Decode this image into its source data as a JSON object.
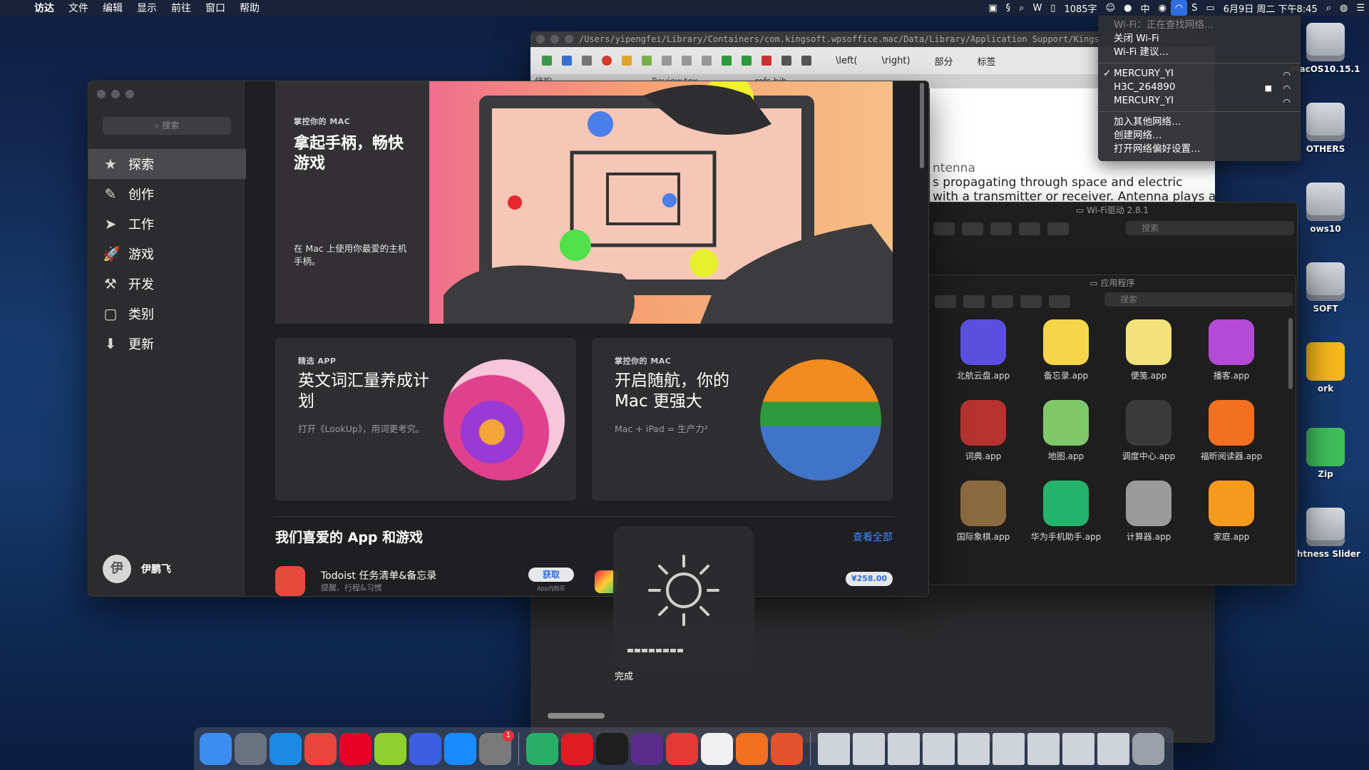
{
  "menubar": {
    "apple": "",
    "items": [
      "访达",
      "文件",
      "编辑",
      "显示",
      "前往",
      "窗口",
      "帮助"
    ],
    "status": {
      "word_count": "1085字",
      "input": "中",
      "datetime": "6月9日 周二 下午8:45"
    }
  },
  "wifi_menu": {
    "status": "Wi-Fi：正在查找网络…",
    "turn_off": "关闭 Wi-Fi",
    "suggestions": "Wi-Fi 建议…",
    "networks": [
      {
        "name": "MERCURY_YI",
        "checked": true,
        "locked": false
      },
      {
        "name": "H3C_264890",
        "checked": false,
        "locked": true
      },
      {
        "name": "MERCURY_YI",
        "checked": false,
        "locked": false
      }
    ],
    "join_other": "加入其他网络…",
    "create": "创建网络…",
    "prefs": "打开网络偏好设置…"
  },
  "desktop": {
    "icons": [
      "MacOS10.15.1",
      "OTHERS",
      "ows10",
      "SOFT",
      "ork",
      "Zip",
      "ghtness Slider"
    ]
  },
  "wps": {
    "path": "/Users/yipengfei/Library/Containers/com.kingsoft.wpsoffice.mac/Data/Library/Application Support/Kingsoft/WPS Cloud Files",
    "toolbar": {
      "left": "\\left(",
      "right": "\\right)",
      "part": "部分",
      "label": "标签"
    },
    "tabs": [
      "结构",
      "Review.tex",
      "refs.bib"
    ],
    "doc_lines": [
      "ntenna",
      "s propagating through space and electric",
      "with a transmitter or receiver.  Antenna plays a"
    ]
  },
  "finder_back": {
    "title": "Wi-Fi驱动 2.8.1",
    "search": "搜索"
  },
  "finder_front": {
    "title": "应用程序",
    "search": "搜索",
    "apps": [
      {
        "name": "北航云盘.app",
        "icon": "beihang-icon",
        "color": "#5b4fe0"
      },
      {
        "name": "备忘录.app",
        "icon": "notes-icon",
        "color": "#f7d54a"
      },
      {
        "name": "便笺.app",
        "icon": "stickies-icon",
        "color": "#f2e27a"
      },
      {
        "name": "播客.app",
        "icon": "podcasts-icon",
        "color": "#b54ad6"
      },
      {
        "name": "词典.app",
        "icon": "dictionary-icon",
        "color": "#b5322f"
      },
      {
        "name": "地图.app",
        "icon": "maps-icon",
        "color": "#7fc86a"
      },
      {
        "name": "调度中心.app",
        "icon": "mission-control-icon",
        "color": "#3a3a3a"
      },
      {
        "name": "福昕阅读器.app",
        "icon": "foxit-reader-icon",
        "color": "#f37021"
      },
      {
        "name": "国际象棋.app",
        "icon": "chess-icon",
        "color": "#8a6a40"
      },
      {
        "name": "华为手机助手.app",
        "icon": "huawei-hisuite-icon",
        "color": "#24b36b"
      },
      {
        "name": "计算器.app",
        "icon": "calculator-icon",
        "color": "#9a9a9a"
      },
      {
        "name": "家庭.app",
        "icon": "home-icon",
        "color": "#f59a1e"
      }
    ]
  },
  "appstore": {
    "search_placeholder": "搜索",
    "nav": [
      {
        "label": "探索",
        "icon": "star-icon",
        "glyph": "★",
        "active": true
      },
      {
        "label": "创作",
        "icon": "hammer-brush-icon",
        "glyph": "✎",
        "active": false
      },
      {
        "label": "工作",
        "icon": "paperplane-icon",
        "glyph": "➤",
        "active": false
      },
      {
        "label": "游戏",
        "icon": "rocket-icon",
        "glyph": "🚀",
        "active": false
      },
      {
        "label": "开发",
        "icon": "hammer-icon",
        "glyph": "⚒",
        "active": false
      },
      {
        "label": "类别",
        "icon": "categories-icon",
        "glyph": "▢",
        "active": false
      },
      {
        "label": "更新",
        "icon": "updates-icon",
        "glyph": "⬇",
        "active": false
      }
    ],
    "user": {
      "initial": "伊",
      "name": "伊鹏飞"
    },
    "hero": {
      "eyebrow": "掌控你的 MAC",
      "title": "拿起手柄，畅快游戏",
      "subtitle": "在 Mac 上使用你最爱的主机手柄。"
    },
    "cards": [
      {
        "eyebrow": "精选 APP",
        "title": "英文词汇量养成计划",
        "desc": "打开《LookUp》，用词更考究。"
      },
      {
        "eyebrow": "掌控你的 MAC",
        "title": "开启随航，你的 Mac 更强大",
        "desc": "Mac + iPad = 生产力²"
      }
    ],
    "section": {
      "title": "我们喜爱的 App 和游戏",
      "see_all": "查看全部"
    },
    "apps": [
      {
        "name": "Todoist 任务清单&备忘录",
        "subtitle": "提醒、行程&习惯",
        "button": "获取",
        "note": "App内购买"
      },
      {
        "price": "¥258.00"
      }
    ]
  },
  "hud": {
    "done": "完成",
    "brightness": 0.5
  },
  "dock": {
    "apps": [
      {
        "icon": "finder-icon",
        "color": "#3d8cf0"
      },
      {
        "icon": "launchpad-icon",
        "color": "#6b7280"
      },
      {
        "icon": "safari-icon",
        "color": "#1e88e5"
      },
      {
        "icon": "chrome-icon",
        "color": "#e8453c"
      },
      {
        "icon": "netease-music-icon",
        "color": "#e60026"
      },
      {
        "icon": "iqiyi-icon",
        "color": "#8fd02e"
      },
      {
        "icon": "wps-icon",
        "color": "#3b5fe0"
      },
      {
        "icon": "app-store-icon",
        "color": "#1a8cff"
      },
      {
        "icon": "system-preferences-icon",
        "color": "#7a7a7a",
        "badge": "1"
      },
      {
        "icon": "wechat-icon",
        "color": "#2aae67"
      },
      {
        "icon": "youdao-icon",
        "color": "#e01b22"
      },
      {
        "icon": "terminal-icon",
        "color": "#1e1e1e"
      },
      {
        "icon": "tex-icon",
        "color": "#5a2c8c"
      },
      {
        "icon": "pdf-expert-icon",
        "color": "#e53935"
      },
      {
        "icon": "textedit-icon",
        "color": "#f0f0f0"
      },
      {
        "icon": "foxit-icon",
        "color": "#f37021"
      },
      {
        "icon": "matlab-icon",
        "color": "#e3532b"
      }
    ],
    "windows": 9
  }
}
